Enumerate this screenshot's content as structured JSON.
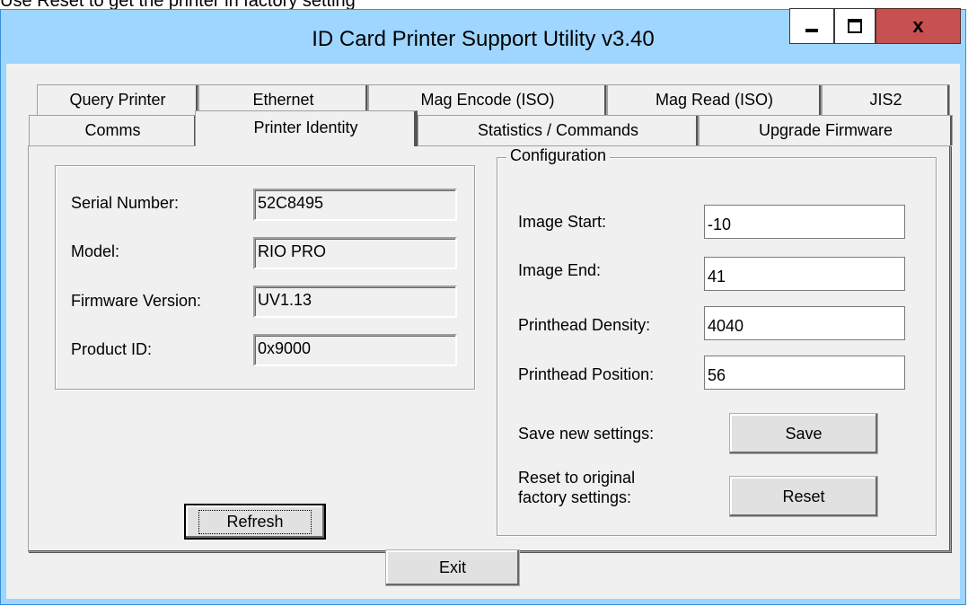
{
  "caption": "Use Reset to get the printer in factory setting",
  "window": {
    "title": "ID Card Printer Support Utility v3.40",
    "controls": {
      "minimize": "minimize",
      "maximize": "maximize",
      "close": "x"
    }
  },
  "tabs": {
    "top_row": [
      "Query Printer",
      "Ethernet",
      "Mag Encode (ISO)",
      "Mag Read (ISO)",
      "JIS2"
    ],
    "bottom_row": [
      "Comms",
      "Printer Identity",
      "Statistics / Commands",
      "Upgrade Firmware"
    ],
    "selected": "Printer Identity"
  },
  "identity": {
    "serial_label": "Serial Number:",
    "serial_value": "52C8495",
    "model_label": "Model:",
    "model_value": "RIO PRO",
    "firmware_label": "Firmware Version:",
    "firmware_value": "UV1.13",
    "product_label": "Product ID:",
    "product_value": "0x9000",
    "refresh_label": "Refresh"
  },
  "configuration": {
    "title": "Configuration",
    "image_start_label": "Image Start:",
    "image_start_value": "-10",
    "image_end_label": "Image End:",
    "image_end_value": "41",
    "density_label": "Printhead Density:",
    "density_value": "4040",
    "position_label": "Printhead Position:",
    "position_value": "56",
    "save_text": "Save new settings:",
    "save_label": "Save",
    "reset_text_1": "Reset to original",
    "reset_text_2": "factory settings:",
    "reset_label": "Reset"
  },
  "footer": {
    "exit_label": "Exit"
  },
  "colors": {
    "titlebar": "#9fd6ff",
    "close_button": "#c75050",
    "face": "#f0f0f0"
  }
}
